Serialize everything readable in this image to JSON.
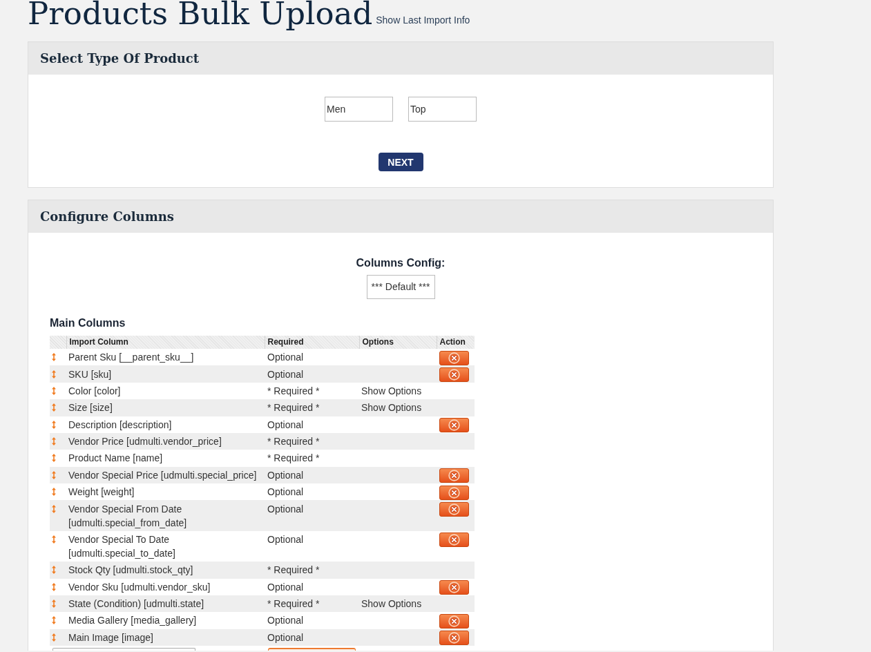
{
  "page": {
    "title": "Products Bulk Upload",
    "link": "Show Last Import Info"
  },
  "product_type_panel": {
    "title": "Select Type Of Product",
    "fields": [
      {
        "value": "Men"
      },
      {
        "value": "Top"
      }
    ],
    "button": "NEXT"
  },
  "columns_panel": {
    "title": "Configure Columns",
    "config_label": "Columns Config:",
    "config_value": "*** Default ***",
    "section_title": "Main Columns",
    "table": {
      "columns": [
        "Import Column",
        "Required",
        "Options",
        "Action"
      ],
      "rows": [
        {
          "column": "Parent Sku [__parent_sku__]",
          "required": "Optional",
          "removable": true
        },
        {
          "column": "SKU [sku]",
          "required": "Optional",
          "removable": true
        },
        {
          "column": "Color [color]",
          "required": "* Required *",
          "options": "Show Options",
          "removable": false
        },
        {
          "column": "Size [size]",
          "required": "* Required *",
          "options": "Show Options",
          "removable": false
        },
        {
          "column": "Description [description]",
          "required": "Optional",
          "removable": true
        },
        {
          "column": "Vendor Price [udmulti.vendor_price]",
          "required": "* Required *",
          "removable": false
        },
        {
          "column": "Product Name [name]",
          "required": "* Required *",
          "removable": false
        },
        {
          "column": "Vendor Special Price [udmulti.special_price]",
          "required": "Optional",
          "removable": true
        },
        {
          "column": "Weight [weight]",
          "required": "Optional",
          "removable": true
        },
        {
          "column": "Vendor Special From Date [udmulti.special_from_date]",
          "required": "Optional",
          "removable": true
        },
        {
          "column": "Vendor Special To Date [udmulti.special_to_date]",
          "required": "Optional",
          "removable": true
        },
        {
          "column": "Stock Qty [udmulti.stock_qty]",
          "required": "* Required *",
          "removable": false
        },
        {
          "column": "Vendor Sku [udmulti.vendor_sku]",
          "required": "Optional",
          "removable": true
        },
        {
          "column": "State (Condition) [udmulti.state]",
          "required": "* Required *",
          "options": "Show Options",
          "removable": false
        },
        {
          "column": "Media Gallery [media_gallery]",
          "required": "Optional",
          "removable": true
        },
        {
          "column": "Main Image [image]",
          "required": "Optional",
          "removable": true
        }
      ]
    }
  }
}
